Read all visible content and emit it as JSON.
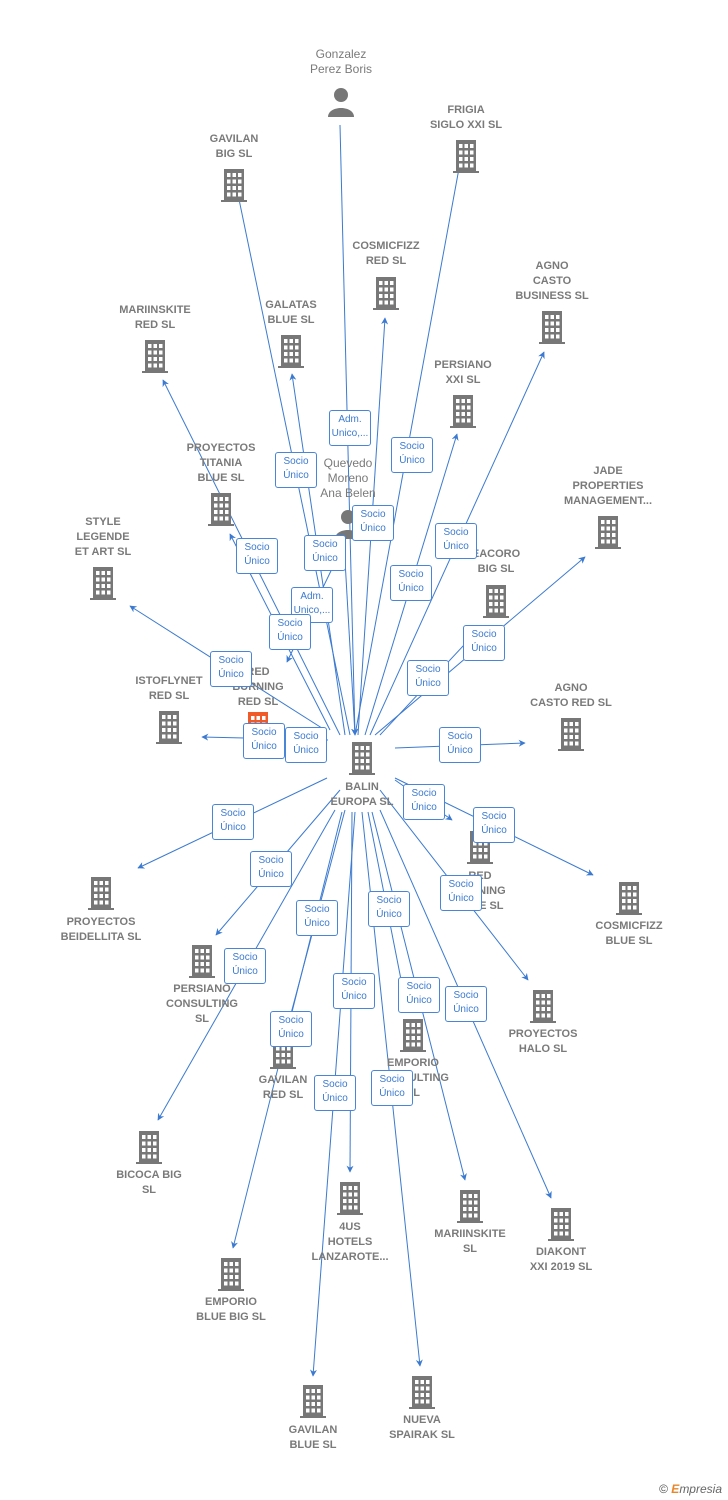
{
  "colors": {
    "edge": "#3b7ad0",
    "node": "#777777",
    "highlight": "#f05a28"
  },
  "center": {
    "label": "BALIN\nEUROPA  SL",
    "icon": "building-icon"
  },
  "nodes": [
    {
      "label": "Gonzalez\nPerez Boris",
      "icon": "person-icon"
    },
    {
      "label": "FRIGIA\nSIGLO XXI  SL",
      "icon": "building-icon"
    },
    {
      "label": "GAVILAN\nBIG  SL",
      "icon": "building-icon"
    },
    {
      "label": "COSMICFIZZ\nRED  SL",
      "icon": "building-icon"
    },
    {
      "label": "AGNO\nCASTO\nBUSINESS  SL",
      "icon": "building-icon"
    },
    {
      "label": "MARIINSKITE\nRED  SL",
      "icon": "building-icon"
    },
    {
      "label": "GALATAS\nBLUE  SL",
      "icon": "building-icon"
    },
    {
      "label": "PERSIANO\nXXI  SL",
      "icon": "building-icon"
    },
    {
      "label": "PROYECTOS\nTITANIA\nBLUE  SL",
      "icon": "building-icon"
    },
    {
      "label": "Quevedo\nMoreno\nAna Belen",
      "icon": "person-icon"
    },
    {
      "label": "JADE\nPROPERTIES\nMANAGEMENT...",
      "icon": "building-icon"
    },
    {
      "label": "STYLE\nLEGENDE\nET ART  SL",
      "icon": "building-icon"
    },
    {
      "label": "EACORO\nBIG  SL",
      "icon": "building-icon"
    },
    {
      "label": "ISTOFLYNET\nRED  SL",
      "icon": "building-icon"
    },
    {
      "label": "RED\nBURNING\nRED  SL",
      "icon": "building-icon-highlight"
    },
    {
      "label": "AGNO\nCASTO RED  SL",
      "icon": "building-icon"
    },
    {
      "label": "PROYECTOS\nBEIDELLITA  SL",
      "icon": "building-icon"
    },
    {
      "label": "RED\nBURNING\nBLUE  SL",
      "icon": "building-icon"
    },
    {
      "label": "COSMICFIZZ\nBLUE  SL",
      "icon": "building-icon"
    },
    {
      "label": "PERSIANO\nCONSULTING\nSL",
      "icon": "building-icon"
    },
    {
      "label": "PROYECTOS\nHALO  SL",
      "icon": "building-icon"
    },
    {
      "label": "GAVILAN\nRED  SL",
      "icon": "building-icon"
    },
    {
      "label": "EMPORIO\nCONSULTING\nSL",
      "icon": "building-icon"
    },
    {
      "label": "BICOCA BIG\nSL",
      "icon": "building-icon"
    },
    {
      "label": "4US\nHOTELS\nLANZAROTE...",
      "icon": "building-icon"
    },
    {
      "label": "MARIINSKITE\nSL",
      "icon": "building-icon"
    },
    {
      "label": "DIAKONT\nXXI 2019  SL",
      "icon": "building-icon"
    },
    {
      "label": "EMPORIO\nBLUE BIG  SL",
      "icon": "building-icon"
    },
    {
      "label": "GAVILAN\nBLUE  SL",
      "icon": "building-icon"
    },
    {
      "label": "NUEVA\nSPAIRAK  SL",
      "icon": "building-icon"
    }
  ],
  "edge_labels": [
    "Adm.\nUnico,...",
    "Socio\nÚnico",
    "Socio\nÚnico",
    "Socio\nÚnico",
    "Socio\nÚnico",
    "Socio\nÚnico",
    "Socio\nÚnico",
    "Adm.\nUnico,...",
    "Socio\nÚnico",
    "Socio\nÚnico",
    "Socio\nÚnico",
    "Socio\nÚnico",
    "Socio\nÚnico",
    "Socio\nÚnico",
    "Socio\nÚnico",
    "Socio\nÚnico",
    "Socio\nÚnico",
    "Socio\nÚnico",
    "Socio\nÚnico",
    "Socio\nÚnico",
    "Socio\nÚnico",
    "Socio\nÚnico",
    "Socio\nÚnico",
    "Socio\nÚnico",
    "Socio\nÚnico",
    "Socio\nÚnico",
    "Socio\nÚnico",
    "Socio\nÚnico",
    "Socio\nÚnico",
    "Socio\nÚnico"
  ],
  "footer": {
    "copyright": "©",
    "brand_initial": "E",
    "brand_rest": "mpresia"
  }
}
